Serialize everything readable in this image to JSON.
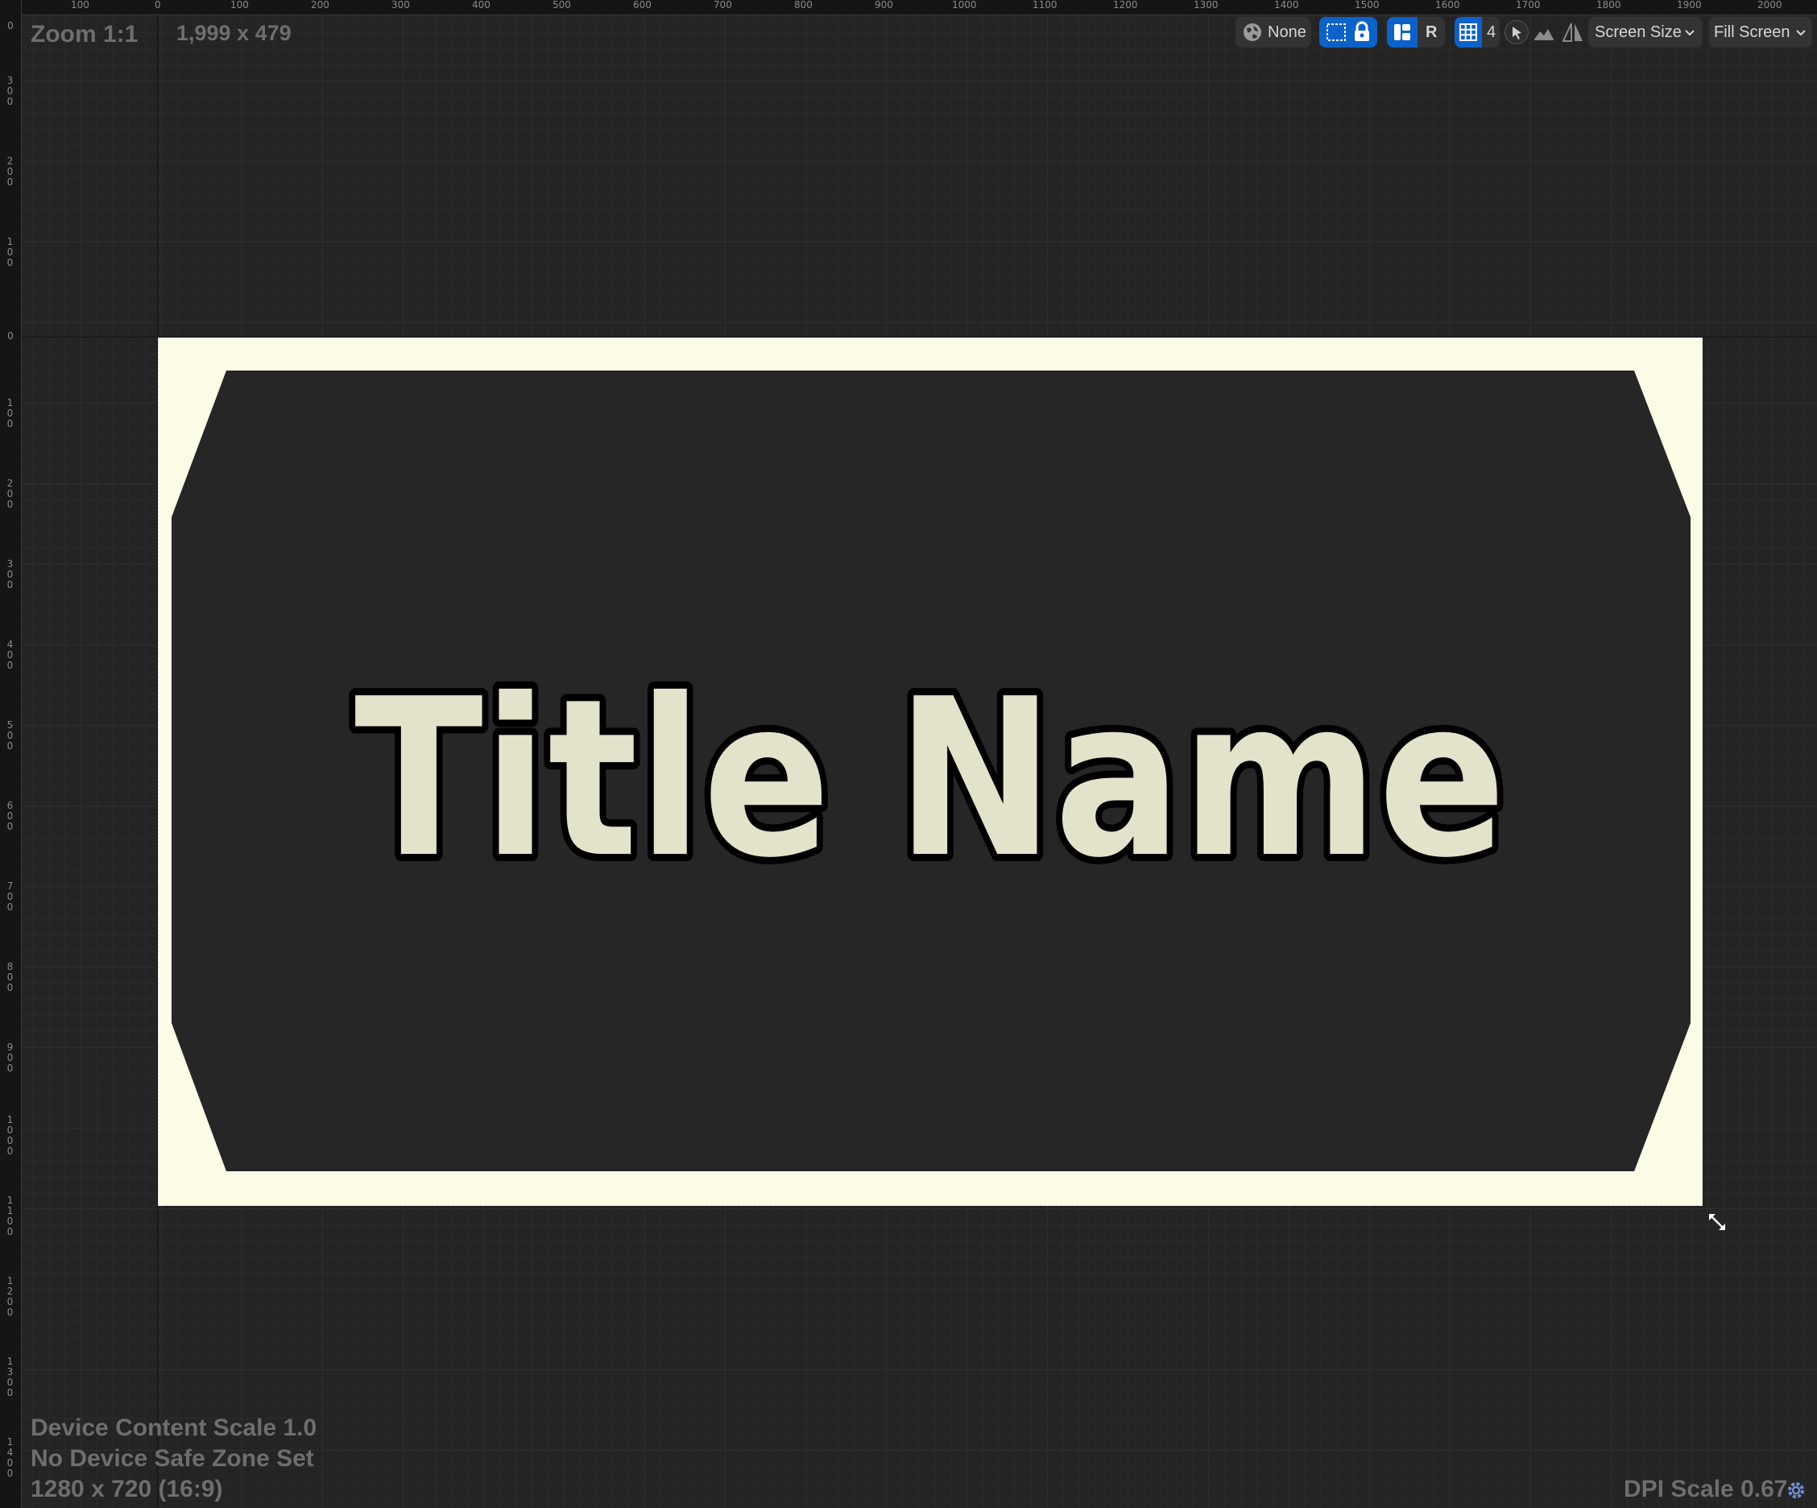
{
  "rulers": {
    "top_labels": [
      "100",
      "0",
      "100",
      "200",
      "300",
      "400",
      "500",
      "600",
      "700",
      "800",
      "900",
      "1000",
      "1100",
      "1200",
      "1300",
      "1400",
      "1500",
      "1600",
      "1700",
      "1800",
      "1900",
      "2000"
    ],
    "left_labels": [
      "0",
      "300",
      "200",
      "100",
      "0",
      "100",
      "200",
      "300",
      "400",
      "500",
      "600",
      "700",
      "800",
      "900",
      "1000",
      "1100",
      "1200",
      "1300",
      "1400"
    ]
  },
  "viewport": {
    "zoom": "Zoom 1:1",
    "size": "1,999 x 479",
    "device_content_scale": "Device Content Scale 1.0",
    "safe_zone": "No Device Safe Zone Set",
    "resolution": "1280 x 720 (16:9)",
    "dpi_scale": "DPI Scale 0.67"
  },
  "toolbar": {
    "localization_label": "None",
    "r_label": "R",
    "grid_value": "4",
    "screen_size_label": "Screen Size",
    "fill_screen_label": "Fill Screen"
  },
  "widget": {
    "title": "Title Name",
    "background_color": "#fcfce6",
    "panel_color": "#262626",
    "text_fill": "#e3e2cb",
    "text_outline": "#000000"
  },
  "colors": {
    "canvas": "#242424",
    "accent_blue": "#0b62c9"
  },
  "icons": [
    "globe-icon",
    "select-icon",
    "lock-icon",
    "layout-icon",
    "grid-icon",
    "cursor-icon",
    "image-icon",
    "mirror-icon",
    "chevron-down-icon",
    "resize-icon",
    "settings-gear-icon"
  ]
}
